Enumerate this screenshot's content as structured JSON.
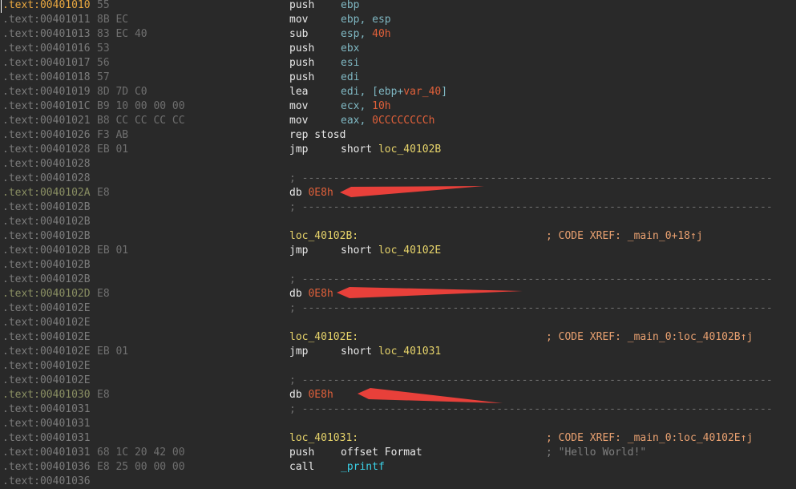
{
  "lines": [
    {
      "addr": ".text:00401010",
      "bytes": "55",
      "mnem": "push",
      "reg": "ebp"
    },
    {
      "addr": ".text:00401011",
      "bytes": "8B EC",
      "mnem": "mov",
      "reg": "ebp, esp"
    },
    {
      "addr": ".text:00401013",
      "bytes": "83 EC 40",
      "mnem": "sub",
      "reg": "esp, ",
      "num": "40h"
    },
    {
      "addr": ".text:00401016",
      "bytes": "53",
      "mnem": "push",
      "reg": "ebx"
    },
    {
      "addr": ".text:00401017",
      "bytes": "56",
      "mnem": "push",
      "reg": "esi"
    },
    {
      "addr": ".text:00401018",
      "bytes": "57",
      "mnem": "push",
      "reg": "edi"
    },
    {
      "addr": ".text:00401019",
      "bytes": "8D 7D C0",
      "mnem": "lea",
      "reg_a": "edi, [ebp+",
      "num": "var_40",
      "reg_b": "]"
    },
    {
      "addr": ".text:0040101C",
      "bytes": "B9 10 00 00 00",
      "mnem": "mov",
      "reg": "ecx, ",
      "num": "10h"
    },
    {
      "addr": ".text:00401021",
      "bytes": "B8 CC CC CC CC",
      "mnem": "mov",
      "reg": "eax, ",
      "num": "0CCCCCCCCh"
    },
    {
      "addr": ".text:00401026",
      "bytes": "F3 AB",
      "mnem": "rep stosd"
    },
    {
      "addr": ".text:00401028",
      "bytes": "EB 01",
      "mnem": "jmp",
      "plain": "short ",
      "sym": "loc_40102B"
    },
    {
      "addr": ".text:00401028"
    },
    {
      "addr": ".text:00401028",
      "dash": "; ---------------------------------------------------------------------------"
    },
    {
      "addr": ".text:0040102A",
      "bytes": "E8",
      "db": "db ",
      "dbv": "0E8h"
    },
    {
      "addr": ".text:0040102B",
      "dash": "; ---------------------------------------------------------------------------"
    },
    {
      "addr": ".text:0040102B"
    },
    {
      "addr": ".text:0040102B",
      "label": "loc_40102B:",
      "comment": "; CODE XREF: _main_0+18↑j"
    },
    {
      "addr": ".text:0040102B",
      "bytes": "EB 01",
      "mnem": "jmp",
      "plain": "short ",
      "sym": "loc_40102E"
    },
    {
      "addr": ".text:0040102B"
    },
    {
      "addr": ".text:0040102B",
      "dash": "; ---------------------------------------------------------------------------"
    },
    {
      "addr": ".text:0040102D",
      "bytes": "E8",
      "db": "db ",
      "dbv": "0E8h"
    },
    {
      "addr": ".text:0040102E",
      "dash": "; ---------------------------------------------------------------------------"
    },
    {
      "addr": ".text:0040102E"
    },
    {
      "addr": ".text:0040102E",
      "label": "loc_40102E:",
      "comment": "; CODE XREF: _main_0:loc_40102B↑j"
    },
    {
      "addr": ".text:0040102E",
      "bytes": "EB 01",
      "mnem": "jmp",
      "plain": "short ",
      "sym": "loc_401031"
    },
    {
      "addr": ".text:0040102E"
    },
    {
      "addr": ".text:0040102E",
      "dash": "; ---------------------------------------------------------------------------"
    },
    {
      "addr": ".text:00401030",
      "bytes": "E8",
      "db": "db ",
      "dbv": "0E8h"
    },
    {
      "addr": ".text:00401031",
      "dash": "; ---------------------------------------------------------------------------"
    },
    {
      "addr": ".text:00401031"
    },
    {
      "addr": ".text:00401031",
      "label": "loc_401031:",
      "comment": "; CODE XREF: _main_0:loc_40102E↑j"
    },
    {
      "addr": ".text:00401031",
      "bytes": "68 1C 20 42 00",
      "mnem": "push",
      "plain": "offset ",
      "white": "Format",
      "string": "; \"Hello World!\""
    },
    {
      "addr": ".text:00401036",
      "bytes": "E8 25 00 00 00",
      "mnem": "call",
      "func": "_printf"
    },
    {
      "addr": ".text:00401036"
    }
  ],
  "colors": {
    "background": "#292929",
    "arrow": "#e8403a"
  }
}
